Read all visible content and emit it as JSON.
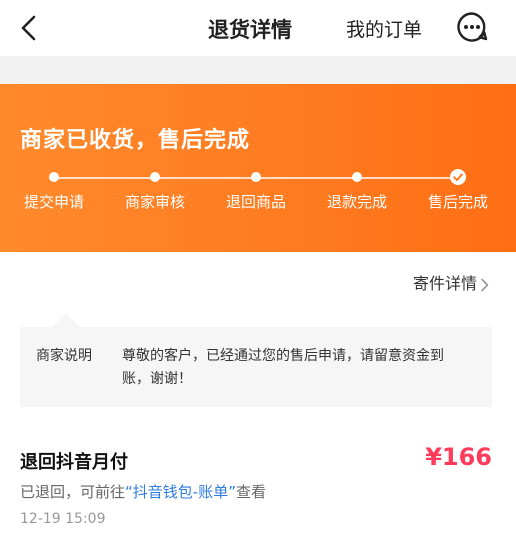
{
  "nav": {
    "title": "退货详情",
    "orders_label": "我的订单",
    "back_icon": "chevron-left-icon",
    "more_icon": "more-bubble-icon"
  },
  "banner": {
    "title": "商家已收货，售后完成",
    "background": "#ff7a1f",
    "steps": [
      {
        "label": "提交申请",
        "state": "done"
      },
      {
        "label": "商家审核",
        "state": "done"
      },
      {
        "label": "退回商品",
        "state": "done"
      },
      {
        "label": "退款完成",
        "state": "done"
      },
      {
        "label": "售后完成",
        "state": "current"
      }
    ]
  },
  "shipping": {
    "link_label": "寄件详情"
  },
  "notice": {
    "label": "商家说明",
    "text": "尊敬的客户，已经通过您的售后申请，请留意资金到账，谢谢！"
  },
  "refund": {
    "title": "退回抖音月付",
    "amount": "¥166",
    "desc_prefix": "已退回，可前往",
    "desc_link": "“抖音钱包-账单”",
    "desc_suffix": "查看",
    "time": "12-19 15:09",
    "amount_color": "#ff3b5c",
    "link_color": "#2e7de1"
  }
}
